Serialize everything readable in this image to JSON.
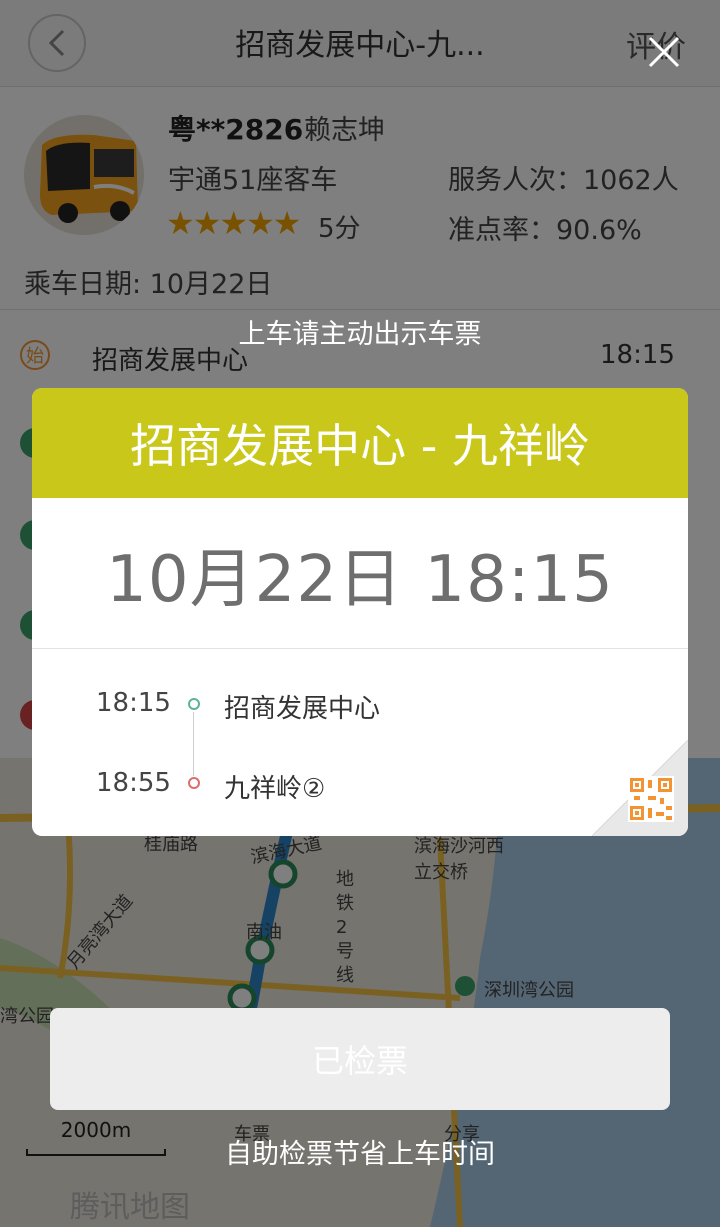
{
  "header": {
    "back_icon": "back-arrow-icon",
    "title": "招商发展中心-九...",
    "rate_label": "评价"
  },
  "bus": {
    "plate": "粤**2826",
    "driver": "赖志坤",
    "model": "宇通51座客车",
    "served": "服务人次：1062人",
    "stars": "★★★★★",
    "rating": 5,
    "score": "5分",
    "punctuality": "准点率：90.6%",
    "ride_date": "乘车日期:  10月22日"
  },
  "route": {
    "start_badge": "始",
    "start_name": "招商发展中心",
    "start_time": "18:15"
  },
  "map": {
    "labels": [
      "桂庙路",
      "滨海大道",
      "滨海沙河西",
      "立交桥",
      "月亮湾大道",
      "地铁2号线",
      "南油",
      "深圳湾公园",
      "湾公园",
      "车票",
      "分享"
    ],
    "scale": "2000m",
    "watermark": "腾讯地图"
  },
  "overlay": {
    "close_icon": "close-icon",
    "hint_top": "上车请主动出示车票",
    "ticket": {
      "route_title": "招商发展中心 - 九祥岭",
      "datetime": "10月22日 18:15",
      "stops": [
        {
          "time": "18:15",
          "name": "招商发展中心"
        },
        {
          "time": "18:55",
          "name": "九祥岭②"
        }
      ],
      "qr_icon": "qr-code-icon"
    },
    "checked_button": "已检票",
    "hint_bottom": "自助检票节省上车时间"
  },
  "colors": {
    "ticket_header": "#c9c71a",
    "star": "#f0a500",
    "start_badge": "#f29434",
    "origin_dot": "#5bb58f",
    "dest_dot": "#e06b6b",
    "qr": "#f29434"
  }
}
